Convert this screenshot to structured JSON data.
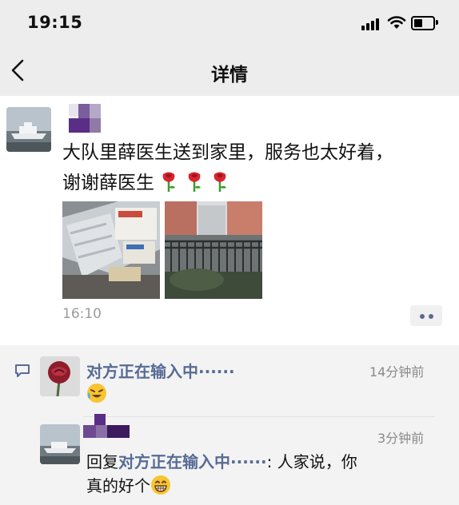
{
  "status_bar": {
    "time": "19:15",
    "icons": [
      "signal-icon",
      "wifi-icon",
      "battery-icon"
    ]
  },
  "nav": {
    "title": "详情",
    "back_icon": "chevron-left-icon"
  },
  "post": {
    "text_line1": "大队里薛医生送到家里，服务也太好着，",
    "text_line2": "谢谢薛医生",
    "rose_emojis": [
      "rose-icon",
      "rose-icon",
      "rose-icon"
    ],
    "time": "16:10",
    "photos": [
      "medicine-boxes-photo",
      "balcony-railing-photo"
    ]
  },
  "comments": [
    {
      "name": "对方正在输入中······",
      "time": "14分钟前",
      "emoji": "laughing-crying-emoji"
    },
    {
      "time": "3分钟前",
      "reply_prefix": "回复",
      "reply_to": "对方正在输入中······",
      "colon": ": ",
      "text_a": "人家说，你",
      "text_b": "真的好个",
      "emoji": "grinning-emoji"
    }
  ],
  "colors": {
    "link": "#576b95",
    "bar_bg": "#ededed",
    "comment_bg": "#f3f3f3",
    "time_gray": "#9b9b9b"
  }
}
